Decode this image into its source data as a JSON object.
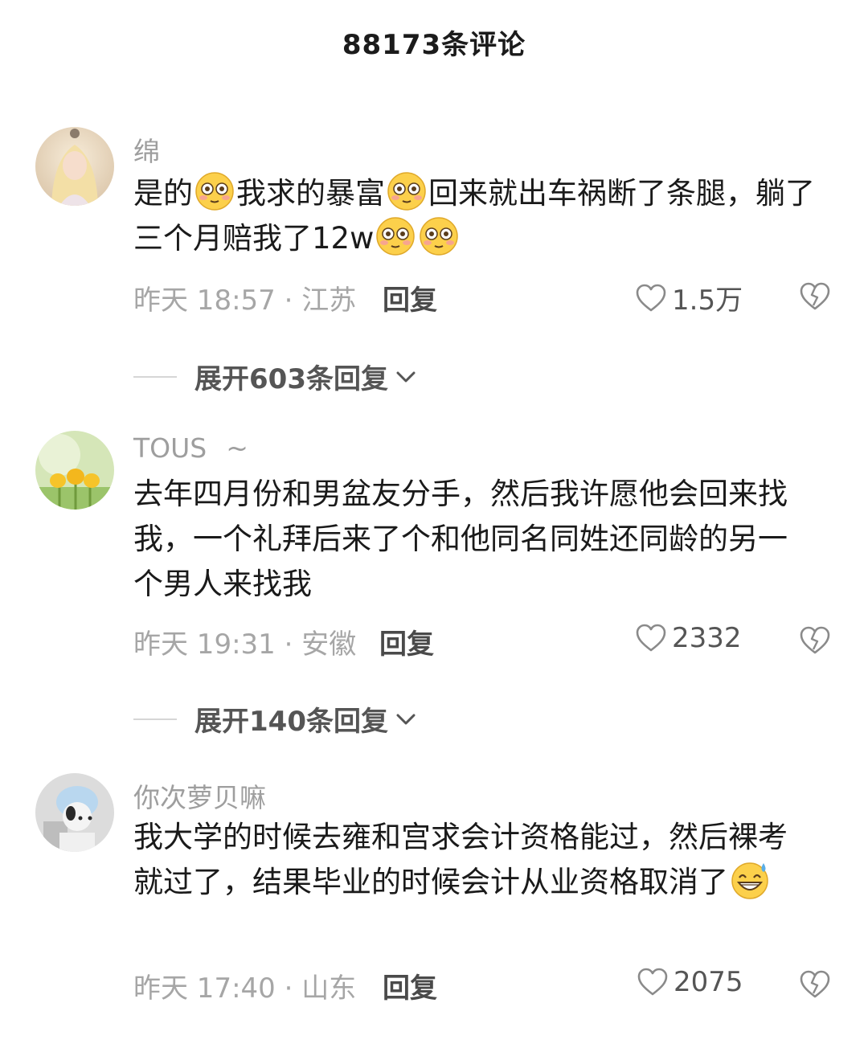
{
  "header": {
    "title": "88173条评论"
  },
  "comments": [
    {
      "username": "绵",
      "text_parts": [
        "是的",
        "我求的暴富",
        "回来就出车祸断了条腿，躺了三个月赔我了12w"
      ],
      "time_location": "昨天 18:57 · 江苏",
      "reply_label": "回复",
      "likes": "1.5万",
      "expand_label": "展开603条回复"
    },
    {
      "username": "TOUS",
      "username_suffix": "~",
      "text": "去年四月份和男盆友分手，然后我许愿他会回来找我，一个礼拜后来了个和他同名同姓还同龄的另一个男人来找我",
      "time_location": "昨天 19:31 · 安徽",
      "reply_label": "回复",
      "likes": "2332",
      "expand_label": "展开140条回复"
    },
    {
      "username": "你次萝贝嘛",
      "text": "我大学的时候去雍和宫求会计资格能过，然后裸考就过了，结果毕业的时候会计从业资格取消了",
      "time_location": "昨天 17:40 · 山东",
      "reply_label": "回复",
      "likes": "2075"
    }
  ],
  "icons": {
    "like": "heart-outline-icon",
    "dislike": "broken-heart-icon",
    "expand": "chevron-down-icon",
    "emoji_1": "flushed-face-emoji",
    "emoji_2": "grinning-sweat-emoji"
  }
}
